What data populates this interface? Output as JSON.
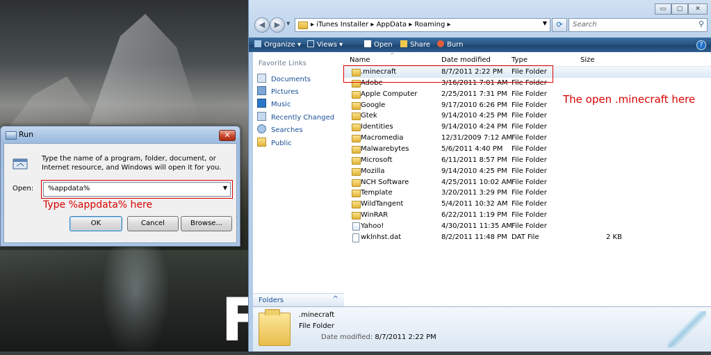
{
  "desktop": {
    "big_letter": "F"
  },
  "run_dialog": {
    "title": "Run",
    "close_glyph": "✕",
    "description": "Type the name of a program, folder, document, or Internet resource, and Windows will open it for you.",
    "open_label": "Open:",
    "open_value": "%appdata%",
    "annotation": "Type %appdata% here",
    "buttons": {
      "ok": "OK",
      "cancel": "Cancel",
      "browse": "Browse..."
    },
    "annotation_color": "#d80000"
  },
  "explorer": {
    "window_controls": [
      "▭",
      "▢",
      "✕"
    ],
    "breadcrumb": [
      "iTunes Installer",
      "AppData",
      "Roaming"
    ],
    "breadcrumb_sep": "▸",
    "search_placeholder": "Search",
    "toolbar": {
      "organize": "Organize ▾",
      "views": "Views ▾",
      "open": "Open",
      "share": "Share",
      "burn": "Burn",
      "help": "?"
    },
    "nav": {
      "favorite_links_title": "Favorite Links",
      "items": [
        "Documents",
        "Pictures",
        "Music",
        "Recently Changed",
        "Searches",
        "Public"
      ],
      "folders_label": "Folders",
      "folders_chevron": "^"
    },
    "columns": {
      "name": "Name",
      "date": "Date modified",
      "type": "Type",
      "size": "Size"
    },
    "files": [
      {
        "name": ".minecraft",
        "date": "8/7/2011 2:22 PM",
        "type": "File Folder",
        "size": "",
        "kind": "folder"
      },
      {
        "name": "Adobe",
        "date": "3/16/2011 7:01 AM",
        "type": "File Folder",
        "size": "",
        "kind": "folder"
      },
      {
        "name": "Apple Computer",
        "date": "2/25/2011 7:31 PM",
        "type": "File Folder",
        "size": "",
        "kind": "folder"
      },
      {
        "name": "Google",
        "date": "9/17/2010 6:26 PM",
        "type": "File Folder",
        "size": "",
        "kind": "folder"
      },
      {
        "name": "Gtek",
        "date": "9/14/2010 4:25 PM",
        "type": "File Folder",
        "size": "",
        "kind": "folder"
      },
      {
        "name": "Identities",
        "date": "9/14/2010 4:24 PM",
        "type": "File Folder",
        "size": "",
        "kind": "folder"
      },
      {
        "name": "Macromedia",
        "date": "12/31/2009 7:12 AM",
        "type": "File Folder",
        "size": "",
        "kind": "folder"
      },
      {
        "name": "Malwarebytes",
        "date": "5/6/2011 4:40 PM",
        "type": "File Folder",
        "size": "",
        "kind": "folder"
      },
      {
        "name": "Microsoft",
        "date": "6/11/2011 8:57 PM",
        "type": "File Folder",
        "size": "",
        "kind": "folder"
      },
      {
        "name": "Mozilla",
        "date": "9/14/2010 4:25 PM",
        "type": "File Folder",
        "size": "",
        "kind": "folder"
      },
      {
        "name": "NCH Software",
        "date": "4/25/2011 10:02 AM",
        "type": "File Folder",
        "size": "",
        "kind": "folder"
      },
      {
        "name": "Template",
        "date": "3/20/2011 3:29 PM",
        "type": "File Folder",
        "size": "",
        "kind": "folder"
      },
      {
        "name": "WildTangent",
        "date": "5/4/2011 10:32 AM",
        "type": "File Folder",
        "size": "",
        "kind": "folder"
      },
      {
        "name": "WinRAR",
        "date": "6/22/2011 1:19 PM",
        "type": "File Folder",
        "size": "",
        "kind": "folder"
      },
      {
        "name": "Yahoo!",
        "date": "4/30/2011 11:35 AM",
        "type": "File Folder",
        "size": "",
        "kind": "webfolder"
      },
      {
        "name": "wklnhst.dat",
        "date": "8/2/2011 11:48 PM",
        "type": "DAT File",
        "size": "2 KB",
        "kind": "file"
      }
    ],
    "annotation": "The open .minecraft here",
    "details": {
      "name": ".minecraft",
      "type": "File Folder",
      "modified_label": "Date modified:",
      "modified_value": "8/7/2011 2:22 PM"
    },
    "accent_toolbar": "#2a5684"
  }
}
